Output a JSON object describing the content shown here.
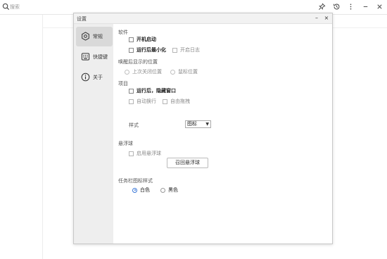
{
  "app": {
    "search_placeholder": "搜索",
    "icons": [
      "search-icon",
      "pin-icon",
      "history-icon",
      "more-icon",
      "minimize-icon",
      "close-icon"
    ]
  },
  "dialog": {
    "title": "设置",
    "minimize_label": "–",
    "close_label": "×",
    "nav": [
      {
        "label": "常规",
        "icon": "gear-icon",
        "active": true
      },
      {
        "label": "快捷键",
        "icon": "keyboard-icon",
        "active": false
      },
      {
        "label": "关于",
        "icon": "info-icon",
        "active": false
      }
    ],
    "software": {
      "title": "软件",
      "autostart": "开机启动",
      "minimize_after_run": "运行后最小化",
      "enable_log": "开启日志"
    },
    "wake_position": {
      "title": "唤醒后显示的位置",
      "last_close": "上次关闭位置",
      "mouse_position": "鼠标位置"
    },
    "project": {
      "title": "项目",
      "hide_after_run": "运行后，隐藏窗口",
      "auto_wrap": "自动换行",
      "free_drag": "自由拖拽",
      "style_label": "样式",
      "style_value": "图标"
    },
    "float_ball": {
      "title": "悬浮球",
      "enable": "启用悬浮球",
      "recall_button": "召回悬浮球"
    },
    "taskbar_icon_style": {
      "title": "任务栏图标样式",
      "white": "白色",
      "black": "黑色",
      "selected": "白色"
    }
  }
}
